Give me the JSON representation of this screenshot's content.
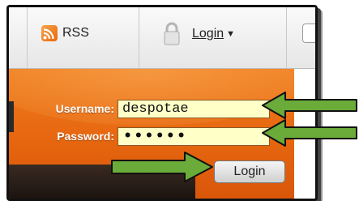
{
  "navbar": {
    "rss_label": "RSS",
    "login_label": "Login",
    "icons": [
      "rss-icon",
      "lock-icon",
      "chevron-down-icon"
    ]
  },
  "login_form": {
    "username_label": "Username:",
    "username_value": "despotae",
    "password_label": "Password:",
    "password_value": "••••••",
    "submit_label": "Login"
  },
  "annotations": {
    "arrow_color": "#6aab3a",
    "arrow_outline": "#111111"
  },
  "colors": {
    "panel_orange": "#e5640e",
    "input_fill": "#ffffc8"
  }
}
